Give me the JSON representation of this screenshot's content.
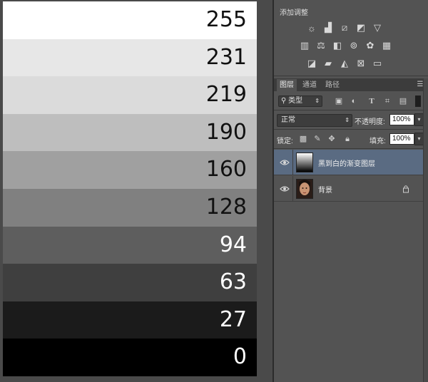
{
  "gradient_bands": [
    {
      "value": "255",
      "color": "#ffffff",
      "text_color": "#111111"
    },
    {
      "value": "231",
      "color": "#e7e7e7",
      "text_color": "#111111"
    },
    {
      "value": "219",
      "color": "#dbdbdb",
      "text_color": "#111111"
    },
    {
      "value": "190",
      "color": "#bebebe",
      "text_color": "#111111"
    },
    {
      "value": "160",
      "color": "#a0a0a0",
      "text_color": "#111111"
    },
    {
      "value": "128",
      "color": "#808080",
      "text_color": "#111111"
    },
    {
      "value": "94",
      "color": "#5e5e5e",
      "text_color": "#ffffff"
    },
    {
      "value": "63",
      "color": "#3f3f3f",
      "text_color": "#ffffff"
    },
    {
      "value": "27",
      "color": "#1b1b1b",
      "text_color": "#ffffff"
    },
    {
      "value": "0",
      "color": "#000000",
      "text_color": "#ffffff"
    }
  ],
  "adjustments": {
    "title": "添加调整",
    "icons": [
      "brightness-contrast-icon",
      "levels-icon",
      "curves-icon",
      "exposure-icon",
      "vibrance-icon",
      "hue-saturation-icon",
      "color-balance-icon",
      "black-white-icon",
      "photo-filter-icon",
      "channel-mixer-icon",
      "color-lookup-icon",
      "invert-icon",
      "posterize-icon",
      "threshold-icon",
      "selective-color-icon",
      "gradient-map-icon"
    ]
  },
  "layers_panel": {
    "tabs": [
      "图层",
      "通道",
      "路径"
    ],
    "active_tab": "图层",
    "filter_kind": "类型",
    "blend_mode": "正常",
    "opacity_label": "不透明度:",
    "opacity_value": "100%",
    "lock_label": "锁定:",
    "fill_label": "填充:",
    "fill_value": "100%",
    "layers": [
      {
        "name": "黑到白的渐变图层",
        "selected": true,
        "locked": false
      },
      {
        "name": "背景",
        "selected": false,
        "locked": true
      }
    ]
  },
  "colors": {
    "panel_bg": "#535353",
    "selected_layer": "#5a6b82",
    "canvas_bg": "#4a4a4a"
  }
}
